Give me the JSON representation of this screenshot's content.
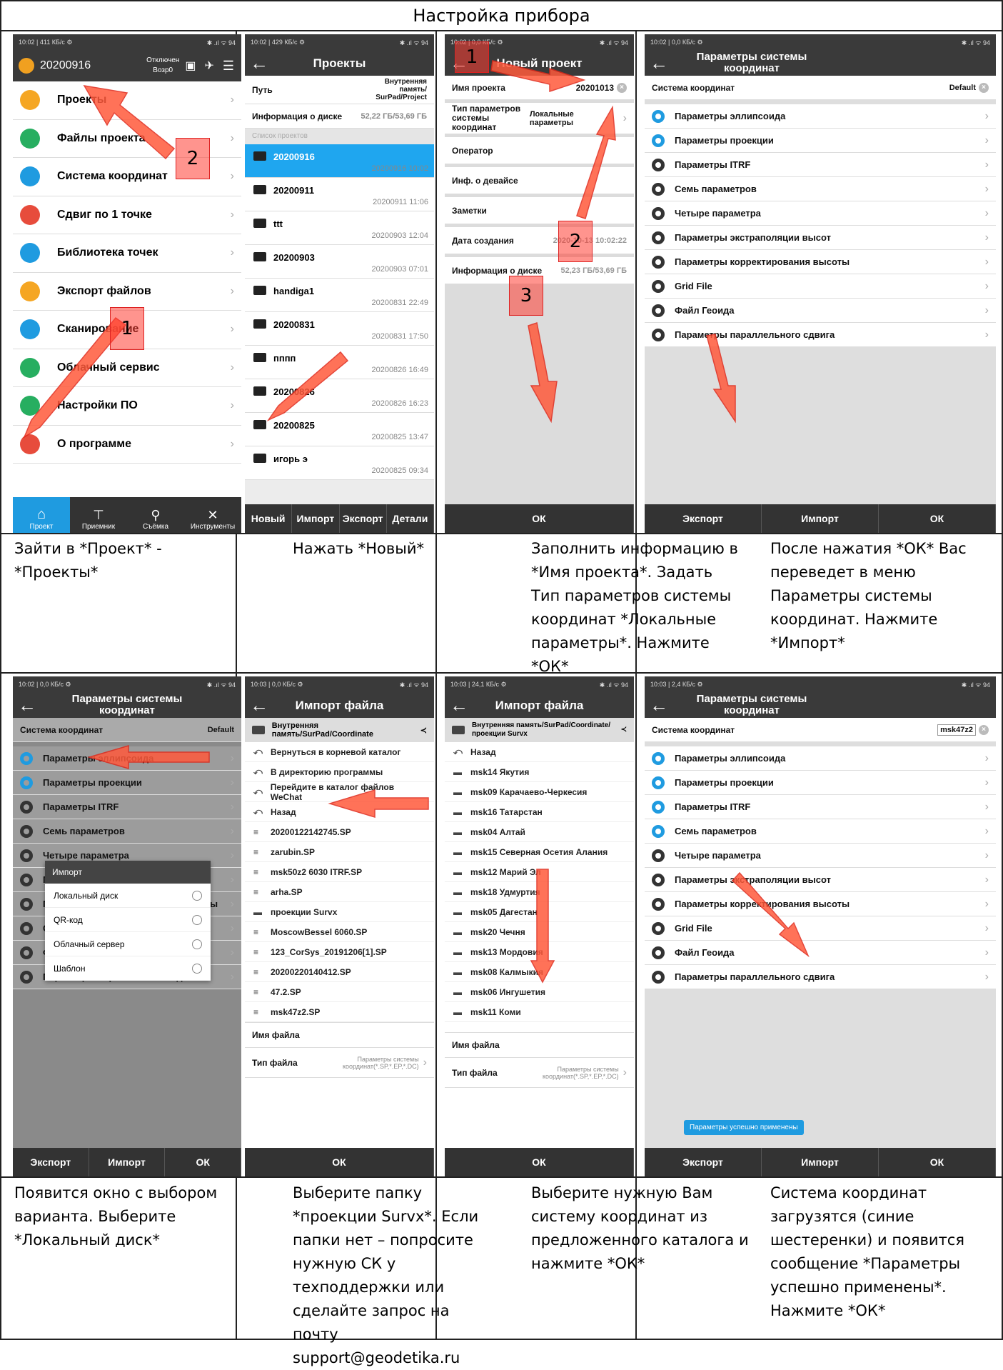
{
  "doc_title": "Настройка прибора",
  "captions": [
    "Зайти в *Проект* - *Проекты*",
    "Нажать *Новый*",
    "Заполнить информацию в *Имя проекта*. Задать Тип параметров системы координат *Локальные параметры*. Нажмите *ОК*",
    "После нажатия *ОК* Вас переведет в меню Параметры системы координат. Нажмите *Импорт*",
    "Появится окно с выбором варианта. Выберите *Локальный диск*",
    "Выберите папку *проекции Survx*. Если папки нет – попросите нужную СК у техподдержки или сделайте запрос на почту support@geodetika.ru",
    "Выберите нужную Вам систему координат из предложенного каталога и нажмите *ОК*",
    "Система координат загрузятся (синие шестеренки) и появится сообщение *Параметры успешно применены*. Нажмите *ОК*"
  ],
  "s1": {
    "status": "10:02 | 411 КБ/с ⚙",
    "status_r": "✱ .ıl ᯤ 94",
    "project": "20200916",
    "state": "Отключен",
    "mode": "Возр0",
    "items": [
      "Проекты",
      "Файлы проекта",
      "Система координат",
      "Сдвиг по 1 точке",
      "Библиотека точек",
      "Экспорт файлов",
      "Сканирование",
      "Облачный сервис",
      "Настройки ПО",
      "О программе"
    ],
    "tabs": [
      "Проект",
      "Приемник",
      "Съёмка",
      "Инструменты"
    ]
  },
  "s2": {
    "status": "10:02 | 429 КБ/с ⚙",
    "title": "Проекты",
    "path_label": "Путь",
    "path_value": "Внутренняя память/ SurPad/Project",
    "disk_label": "Информация о диске",
    "disk_value": "52,22 ГБ/53,69 ГБ",
    "list_label": "Список проектов",
    "projects": [
      {
        "name": "20200916",
        "date": "20200916 10:02"
      },
      {
        "name": "20200911",
        "date": "20200911 11:06"
      },
      {
        "name": "ttt",
        "date": "20200903 12:04"
      },
      {
        "name": "20200903",
        "date": "20200903 07:01"
      },
      {
        "name": "handiga1",
        "date": "20200831 22:49"
      },
      {
        "name": "20200831",
        "date": "20200831 17:50"
      },
      {
        "name": "пппп",
        "date": "20200826 16:49"
      },
      {
        "name": "20200826",
        "date": "20200826 16:23"
      },
      {
        "name": "20200825",
        "date": "20200825 13:47"
      },
      {
        "name": "игорь э",
        "date": "20200825 09:34"
      }
    ],
    "buttons": [
      "Новый",
      "Импорт",
      "Экспорт",
      "Детали"
    ]
  },
  "s3": {
    "status": "10:02 | 0,0 КБ/с ⚙",
    "title": "Новый проект",
    "name_label": "Имя проекта",
    "name_value": "20201013",
    "type_label": "Тип параметров системы координат",
    "type_value": "Локальные параметры",
    "operator": "Оператор",
    "device": "Инф. о девайсе",
    "notes": "Заметки",
    "created_label": "Дата создания",
    "created_value": "2020-10-13 10:02:22",
    "disk_label": "Информация о диске",
    "disk_value": "52,23 ГБ/53,69 ГБ",
    "ok": "ОК"
  },
  "s4": {
    "status": "10:02 | 0,0 КБ/с ⚙",
    "title": "Параметры системы координат",
    "cs_label": "Система координат",
    "cs_value": "Default",
    "items": [
      "Параметры эллипсоида",
      "Параметры проекции",
      "Параметры ITRF",
      "Семь параметров",
      "Четыре параметра",
      "Параметры экстраполяции высот",
      "Параметры корректирования высоты",
      "Grid File",
      "Файл Геоида",
      "Параметры параллельного сдвига"
    ],
    "buttons": [
      "Экспорт",
      "Импорт",
      "ОК"
    ]
  },
  "s5": {
    "status": "10:02 | 0,0 КБ/с ⚙",
    "dialog_title": "Импорт",
    "options": [
      "Локальный диск",
      "QR-код",
      "Облачный сервер",
      "Шаблон"
    ]
  },
  "s6": {
    "status": "10:03 | 0,0 КБ/с ⚙",
    "title": "Импорт файла",
    "path": "Внутренняя память/SurPad/Coordinate",
    "entries": [
      "Вернуться в корневой каталог",
      "В директорию программы",
      "Перейдите в каталог файлов WeChat",
      "Назад",
      "20200122142745.SP",
      "zarubin.SP",
      "msk50z2 6030 ITRF.SP",
      "arha.SP",
      "проекции Survx",
      "MoscowBessel 6060.SP",
      "123_CorSys_20191206[1].SP",
      "20200220140412.SP",
      "47.2.SP",
      "msk47z2.SP"
    ],
    "file_name": "Имя файла",
    "file_type": "Тип файла",
    "file_type_value": "Параметры системы координат(*.SP,*.EP,*.DC)",
    "ok": "ОК"
  },
  "s7": {
    "status": "10:03 | 24,1 КБ/с ⚙",
    "title": "Импорт файла",
    "path": "Внутренняя память/SurPad/Coordinate/ проекции Survx",
    "entries": [
      "Назад",
      "msk14 Якутия",
      "msk09 Карачаево-Черкесия",
      "msk16 Татарстан",
      "msk04 Алтай",
      "msk15 Северная Осетия Алания",
      "msk12 Марий Эл",
      "msk18 Удмуртия",
      "msk05 Дагестан",
      "msk20 Чечня",
      "msk13 Мордовия",
      "msk08 Калмыкия",
      "msk06 Ингушетия",
      "msk11 Коми"
    ],
    "file_name": "Имя файла",
    "file_type": "Тип файла",
    "file_type_value": "Параметры системы координат(*.SP,*.EP,*.DC)",
    "ok": "ОК"
  },
  "s8": {
    "status": "10:03 | 2,4 КБ/с ⚙",
    "cs_value": "msk47z2",
    "toast": "Параметры успешно применены"
  },
  "markers": {
    "m1": "1",
    "m2": "2",
    "m3": "3"
  }
}
